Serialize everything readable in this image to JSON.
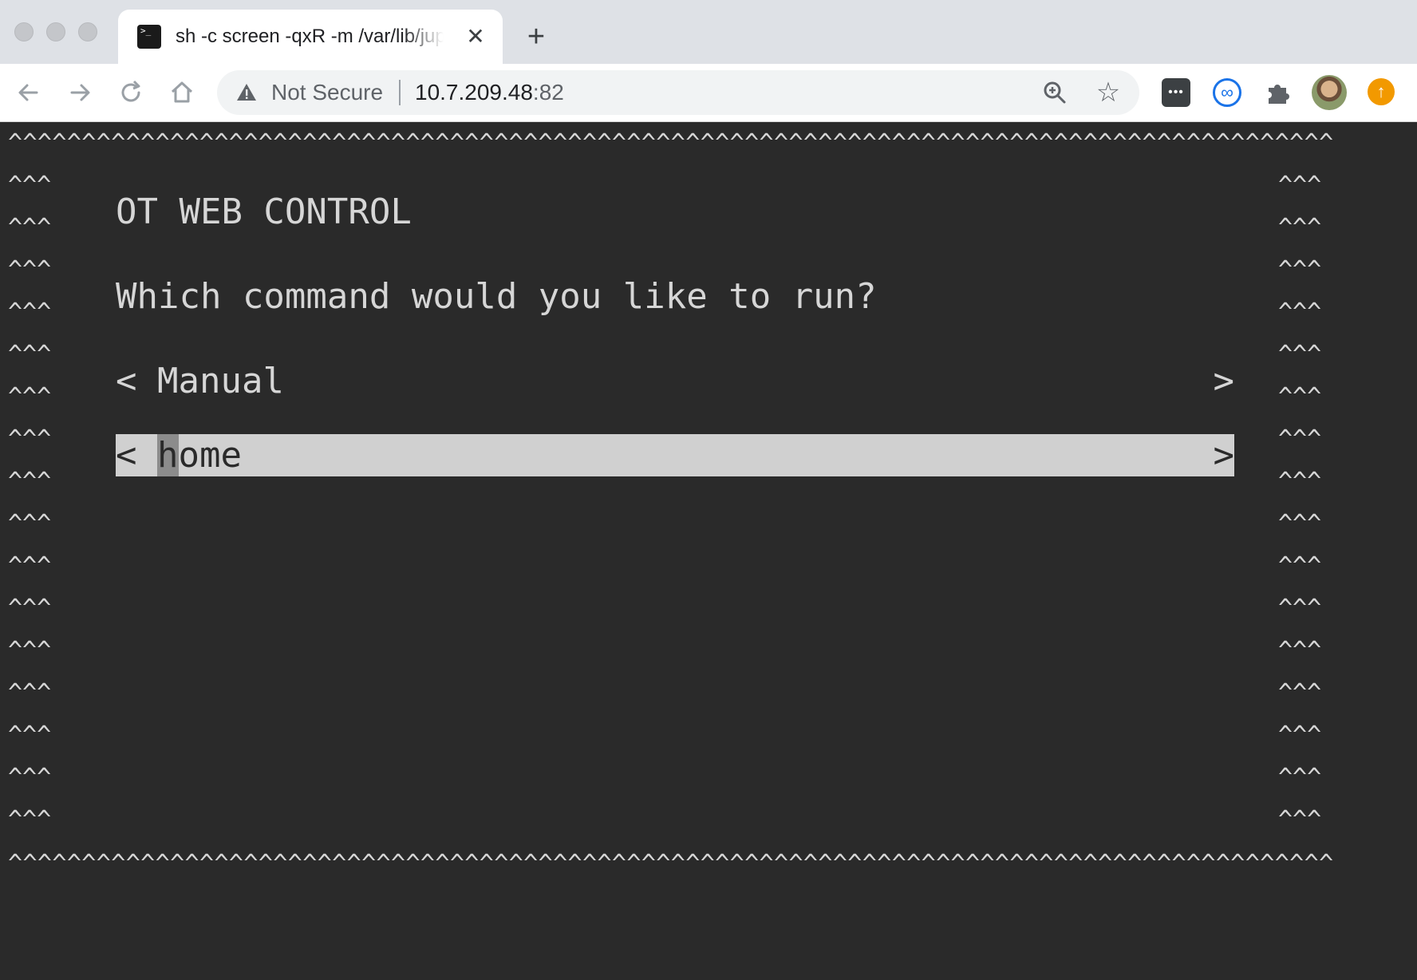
{
  "browser": {
    "tab": {
      "title": "sh -c screen -qxR -m /var/lib/jupyter",
      "favicon_text": ">_"
    },
    "new_tab_symbol": "+",
    "close_symbol": "✕",
    "address": {
      "security_label": "Not Secure",
      "host": "10.7.209.48",
      "port": ":82"
    },
    "icons": [
      "back-arrow-icon",
      "forward-arrow-icon",
      "reload-icon",
      "home-icon",
      "warning-icon",
      "zoom-icon",
      "star-icon",
      "password-manager-icon",
      "infinity-extension-icon",
      "puzzle-extensions-icon",
      "profile-avatar",
      "update-icon"
    ]
  },
  "terminal": {
    "caret_row": "^^^^^^^^^^^^^^^^^^^^^^^^^^^^^^^^^^^^^^^^^^^^^^^^^^^^^^^^^^^^^^^^^^^^^^^^^^^^^^^^^^^^^^^^^^^^^^^^^^^^^^^^^^^^^^^^^^^^^^^^^^^^^^^^^^^^^^^^^^^^^^^^^^^^^",
    "side_caret": "^^^",
    "title": "OT WEB CONTROL",
    "question": "Which command would you like to run?",
    "menu": [
      {
        "arrow_left": "<",
        "label": "Manual",
        "arrow_right": ">",
        "selected": false
      },
      {
        "arrow_left": "<",
        "label": "home",
        "arrow_right": ">",
        "selected": true
      }
    ],
    "colors": {
      "background": "#2a2a2a",
      "text": "#d6d6d6",
      "selection": "#d0d0d0"
    }
  }
}
